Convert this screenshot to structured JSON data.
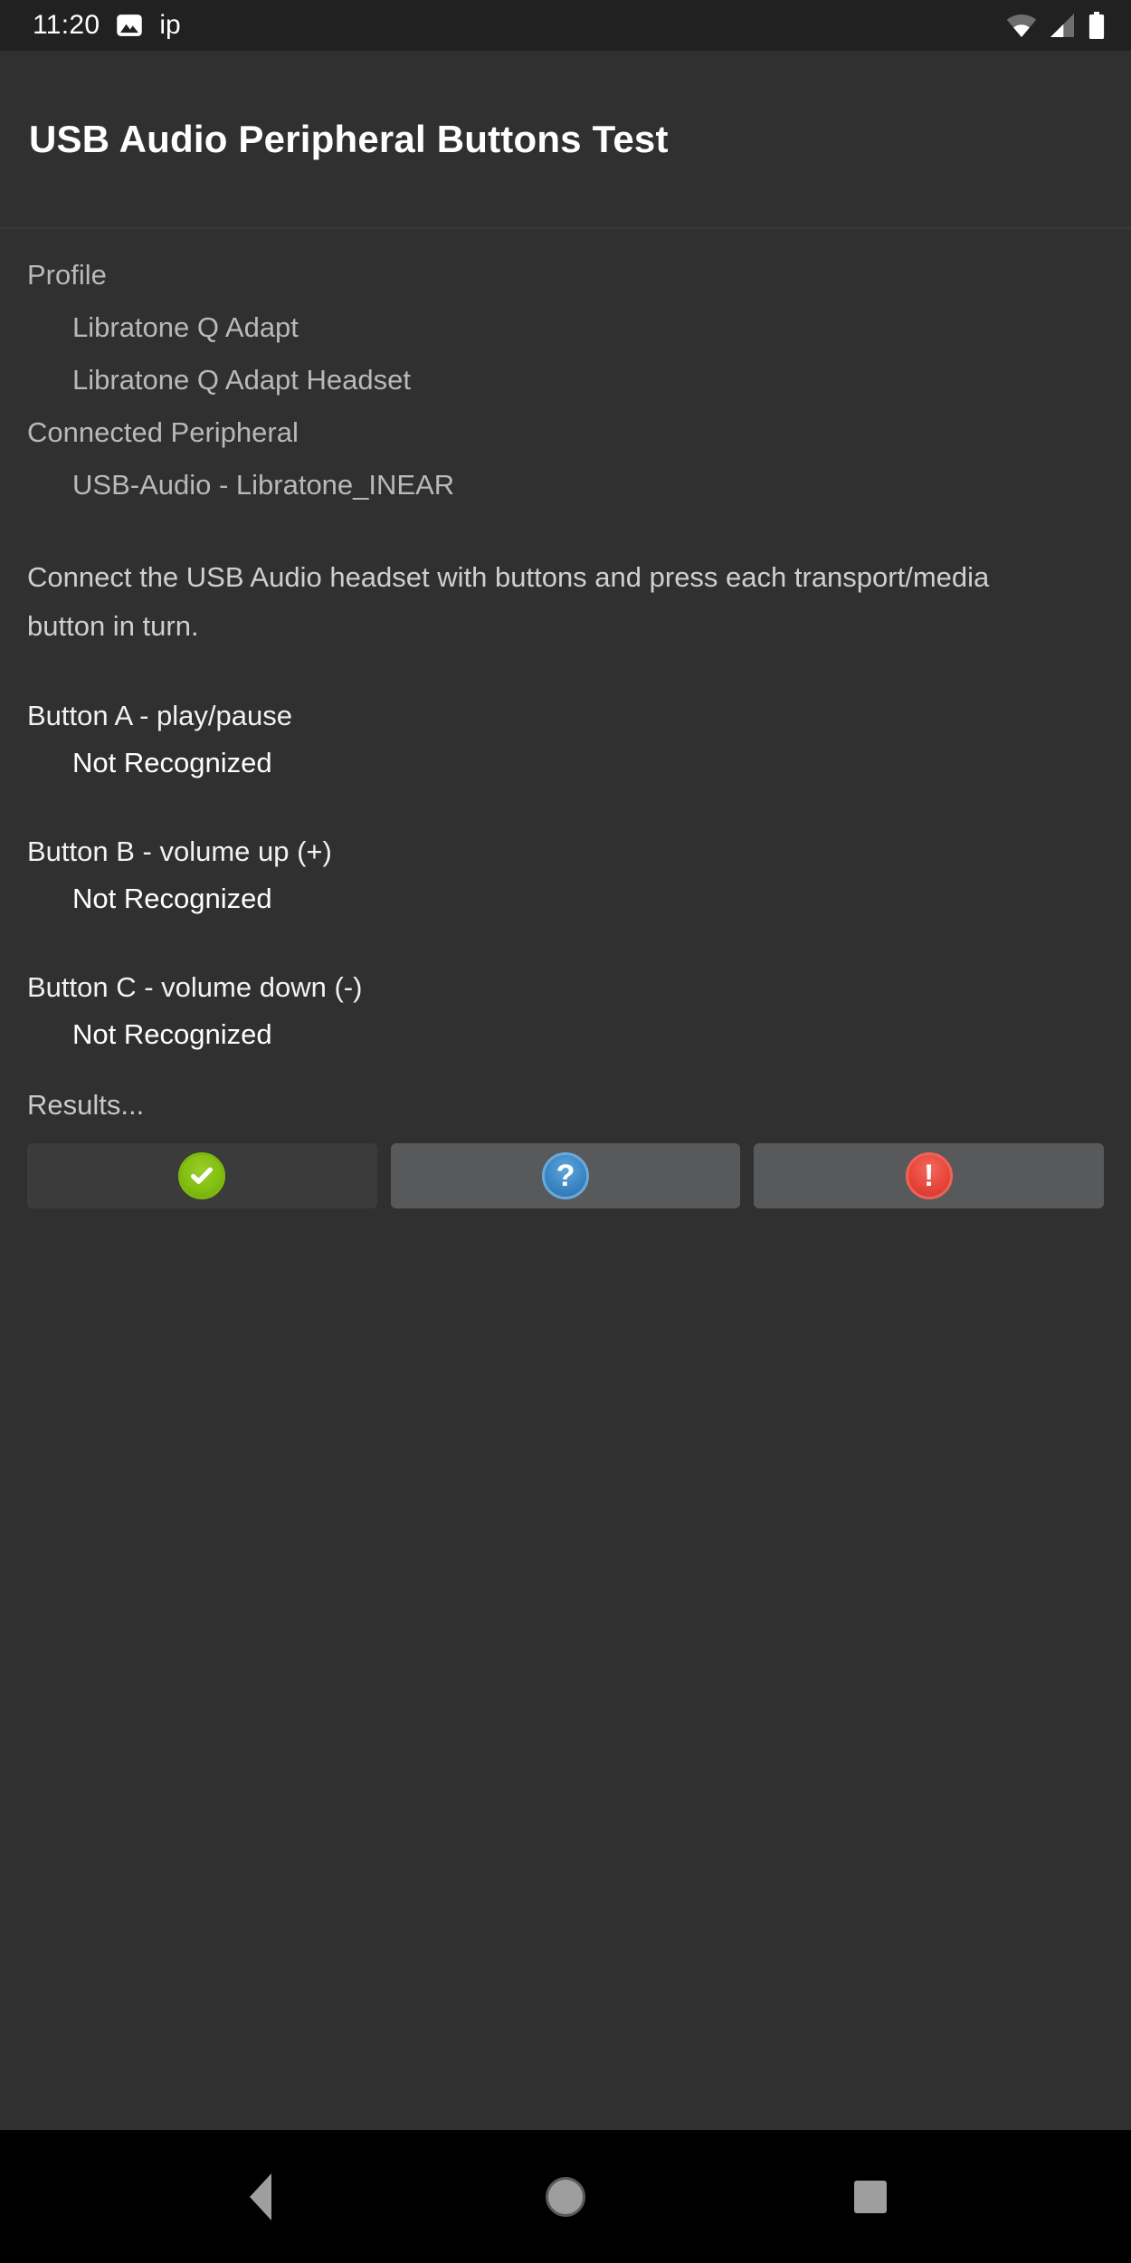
{
  "status_bar": {
    "clock": "11:20",
    "notification_text": "ip",
    "icons": [
      "photo-icon",
      "wifi-icon",
      "cell-signal-icon",
      "battery-icon"
    ]
  },
  "title_bar": {
    "title": "USB Audio Peripheral Buttons Test"
  },
  "info": {
    "profile_header": "Profile",
    "profile_values": [
      "Libratone Q Adapt",
      "Libratone Q Adapt Headset"
    ],
    "connected_header": "Connected Peripheral",
    "connected_value": "USB-Audio - Libratone_INEAR"
  },
  "instructions": "Connect the USB Audio headset with buttons and press each transport/media button in turn.",
  "buttons": [
    {
      "label": "Button A - play/pause",
      "status": "Not Recognized"
    },
    {
      "label": "Button B - volume up (+)",
      "status": "Not Recognized"
    },
    {
      "label": "Button C - volume down (-)",
      "status": "Not Recognized"
    }
  ],
  "results": {
    "label": "Results...",
    "pass": {
      "name": "pass-button",
      "glyph": "✔",
      "color": "#84c011",
      "enabled": false
    },
    "info": {
      "name": "info-button",
      "glyph": "?",
      "color": "#3c86c4",
      "enabled": true
    },
    "fail": {
      "name": "fail-button",
      "glyph": "!",
      "color": "#e8463a",
      "enabled": true
    }
  },
  "nav_bar": {
    "back_label": "Back",
    "home_label": "Home",
    "recents_label": "Recents"
  }
}
